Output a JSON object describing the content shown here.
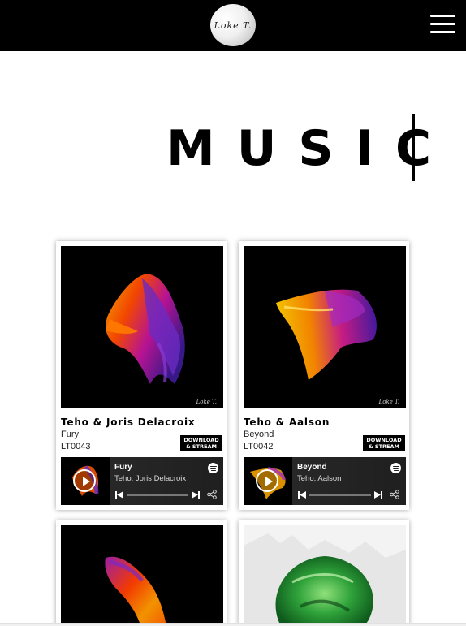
{
  "header": {
    "logo_text": "Loke T.",
    "menu_icon": "hamburger-menu-icon"
  },
  "page": {
    "title": "MUSIC"
  },
  "releases": [
    {
      "artist": "Teho & Joris Delacroix",
      "track": "Fury",
      "catalog": "LT0043",
      "download_label_line1": "DOWNLOAD",
      "download_label_line2": "& STREAM",
      "player": {
        "title": "Fury",
        "artists": "Teho, Joris Delacroix",
        "service_icon": "spotify-icon"
      }
    },
    {
      "artist": "Teho & Aalson",
      "track": "Beyond",
      "catalog": "LT0042",
      "download_label_line1": "DOWNLOAD",
      "download_label_line2": "& STREAM",
      "player": {
        "title": "Beyond",
        "artists": "Teho, Aalson",
        "service_icon": "spotify-icon"
      }
    },
    {
      "artist": "",
      "track": "",
      "catalog": ""
    },
    {
      "artist": "",
      "track": "",
      "catalog": ""
    }
  ],
  "colors": {
    "header_bg": "#000000",
    "player_bg": "#2b2b2b",
    "button_bg": "#000000"
  }
}
